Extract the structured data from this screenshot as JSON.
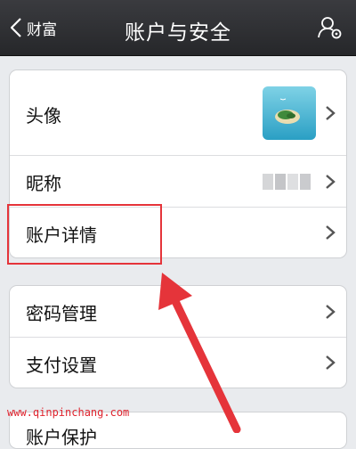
{
  "navbar": {
    "back_label": "财富",
    "title": "账户与安全",
    "right_icon": "user-settings-icon"
  },
  "group1": {
    "rows": [
      {
        "label": "头像"
      },
      {
        "label": "昵称"
      },
      {
        "label": "账户详情"
      }
    ]
  },
  "group2": {
    "rows": [
      {
        "label": "密码管理"
      },
      {
        "label": "支付设置"
      }
    ]
  },
  "group3": {
    "rows": [
      {
        "label": "账户保护"
      }
    ]
  },
  "watermark": "www.qinpinchang.com",
  "colors": {
    "nav_bg": "#2f3033",
    "highlight": "#e5343a",
    "watermark": "#e0242e"
  }
}
